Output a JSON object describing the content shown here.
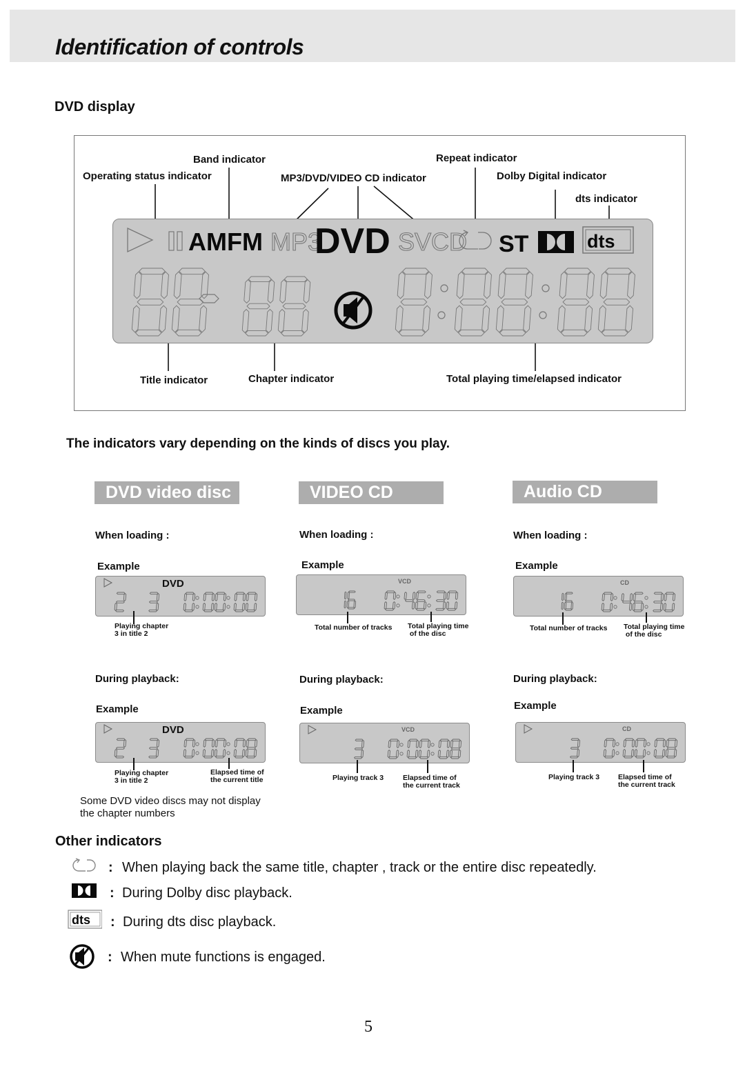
{
  "page": {
    "title": "Identification of controls",
    "page_number": "5"
  },
  "dvd_display": {
    "heading": "DVD display",
    "callouts": {
      "band": "Band  indicator",
      "operating_status": "Operating status  indicator",
      "format": "MP3/DVD/VIDEO CD indicator",
      "repeat": "Repeat  indicator",
      "dolby": "Dolby Digital  indicator",
      "dts": "dts  indicator",
      "title": "Title  indicator",
      "chapter": "Chapter  indicator",
      "time": "Total playing time/elapsed  indicator"
    },
    "segments": {
      "pause": "II",
      "band": "AMFM",
      "mp3": "MP3",
      "dvd": "DVD",
      "svcd": "SVCD",
      "stereo": "ST",
      "dts": "dts"
    }
  },
  "vary_note": "The indicators vary depending on the kinds of discs you play.",
  "discs": [
    {
      "name": "DVD video disc",
      "loading_label": "When loading :",
      "example_label": "Example",
      "loading_lcd": {
        "tag": "DVD",
        "show_play": true,
        "left_digits": "2 3",
        "time": "0:00:00"
      },
      "loading_notes": [
        "Playing chapter\n3 in title 2"
      ],
      "playback_label": "During playback:",
      "playback_example_label": "Example",
      "playback_lcd": {
        "tag": "DVD",
        "show_play": true,
        "left_digits": "2 3",
        "time": "0:00:08"
      },
      "playback_notes": [
        "Playing chapter\n3 in title 2",
        "Elapsed time of\nthe current title"
      ],
      "footnote": "Some DVD video discs may not display\nthe chapter numbers"
    },
    {
      "name": "VIDEO CD",
      "loading_label": "When loading :",
      "example_label": "Example",
      "loading_lcd": {
        "tag": "VCD",
        "show_play": false,
        "left_digits": "16",
        "time": "0:46:30"
      },
      "loading_notes": [
        "Total number of tracks",
        "Total playing time\n of the disc"
      ],
      "playback_label": "During playback:",
      "playback_example_label": "Example",
      "playback_lcd": {
        "tag": "VCD",
        "show_play": true,
        "left_digits": "3",
        "time": "0:00:08"
      },
      "playback_notes": [
        "Playing track 3",
        "Elapsed time of\nthe current track"
      ]
    },
    {
      "name": "Audio CD",
      "loading_label": "When loading :",
      "example_label": "Example",
      "loading_lcd": {
        "tag": "CD",
        "show_play": false,
        "left_digits": "16",
        "time": "0:46:30"
      },
      "loading_notes": [
        "Total number of tracks",
        "Total playing time\n of the disc"
      ],
      "playback_label": "During playback:",
      "playback_example_label": "Example",
      "playback_lcd": {
        "tag": "CD",
        "show_play": true,
        "left_digits": "3",
        "time": "0:00:08"
      },
      "playback_notes": [
        "Playing track 3",
        "Elapsed time of\nthe current track"
      ]
    }
  ],
  "other_indicators": {
    "heading": "Other indicators",
    "items": [
      {
        "icon": "repeat-icon",
        "text": "When playing back the same title, chapter , track or the entire disc repeatedly."
      },
      {
        "icon": "dolby-digital-icon",
        "text": "During Dolby disc  playback."
      },
      {
        "icon": "dts-icon",
        "text": "During dts disc playback."
      },
      {
        "icon": "mute-icon",
        "text": "When mute functions is engaged."
      }
    ],
    "separator": ":"
  },
  "colors": {
    "header_band": "#e6e6e6",
    "lcd_background": "#c8c8c8",
    "disc_header": "#adadad"
  }
}
